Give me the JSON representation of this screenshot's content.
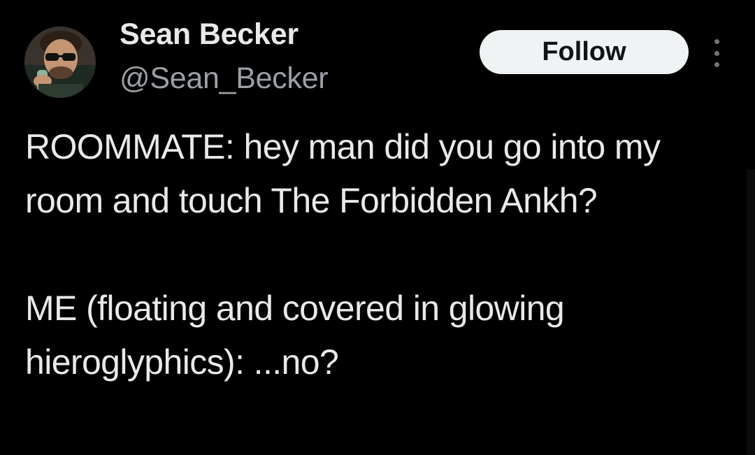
{
  "author": {
    "display_name": "Sean Becker",
    "handle": "@Sean_Becker",
    "avatar_icon": "profile-photo"
  },
  "actions": {
    "follow_label": "Follow",
    "more_icon": "vertical-ellipsis-icon"
  },
  "tweet": {
    "paragraphs": [
      "ROOMMATE: hey man did you go into my room and touch The Forbidden Ankh?",
      "ME (floating and covered in glowing hieroglyphics): ...no?"
    ]
  },
  "colors": {
    "background": "#000000",
    "text_primary": "#e7e9ea",
    "text_secondary": "#9aa0a5",
    "follow_button_bg": "#eff3f4",
    "follow_button_text": "#0f1419"
  }
}
